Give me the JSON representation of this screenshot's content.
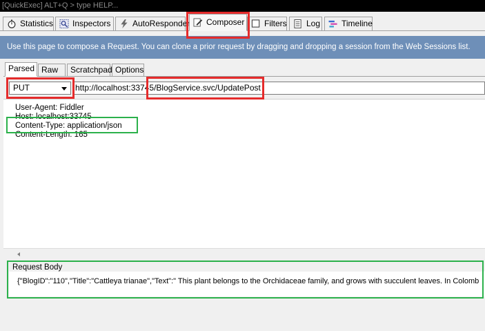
{
  "quickexec": {
    "text": "[QuickExec] ALT+Q > type HELP..."
  },
  "tabs": [
    {
      "label": "Statistics",
      "icon": "stopwatch-icon"
    },
    {
      "label": "Inspectors",
      "icon": "magnifier-icon"
    },
    {
      "label": "AutoResponder",
      "icon": "lightning-icon"
    },
    {
      "label": "Composer",
      "icon": "pencil-icon",
      "active": true
    },
    {
      "label": "Filters",
      "icon": "checkbox-icon"
    },
    {
      "label": "Log",
      "icon": "document-icon"
    },
    {
      "label": "Timeline",
      "icon": "timeline-icon"
    }
  ],
  "banner": {
    "text": "Use this page to compose a Request. You can clone a prior request by dragging and dropping a session from the Web Sessions list."
  },
  "subtabs": [
    "Parsed",
    "Raw",
    "Scratchpad",
    "Options"
  ],
  "request": {
    "method": "PUT",
    "url": "http://localhost:33745/BlogService.svc/UpdatePost"
  },
  "headers": [
    "User-Agent: Fiddler",
    "Host: localhost:33745",
    "Content-Type: application/json",
    "Content-Length: 165"
  ],
  "body": {
    "label": "Request Body",
    "text": "{\"BlogID\":\"110\",\"Title\":\"Cattleya trianae\",\"Text\":\" This plant belongs to the Orchidaceae family, and grows  with succulent leaves. In Colomb"
  },
  "colors": {
    "banner": "#6e8fb8",
    "highlight_red": "#e52b2b",
    "highlight_green": "#2bb14b"
  }
}
